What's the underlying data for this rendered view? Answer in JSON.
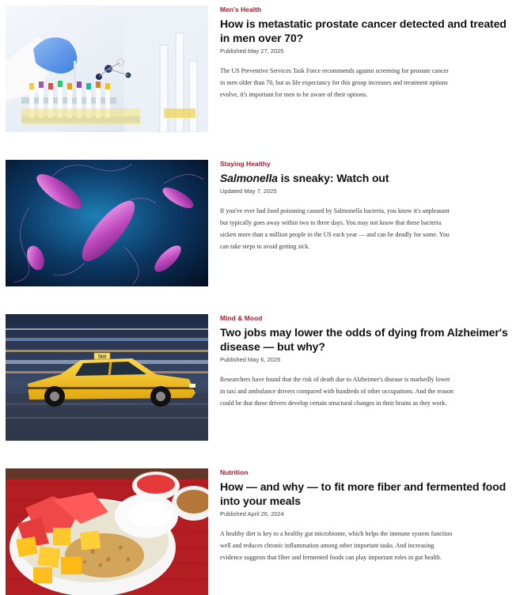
{
  "articles": [
    {
      "category": "Men's Health",
      "title": "How is metastatic prostate cancer detected and treated in men over 70?",
      "date": "Published May 27, 2025",
      "summary": "The US Preventive Services Task Force recommends against screening for prostate cancer in men older than 70, but as life expectancy for this group increases and treatment options evolve, it's important for men to be aware of their options.",
      "image": "lab-test-tubes-image"
    },
    {
      "category": "Staying Healthy",
      "title_italic": "Salmonella",
      "title_rest": " is sneaky: Watch out",
      "date": "Updated May 7, 2025",
      "summary": "If you've ever had food poisoning caused by Salmonella bacteria, you know it's unpleasant but typically goes away within two to three days. You may not know that these bacteria sicken more than a million people in the US each year — and can be deadly for some. You can take steps to avoid getting sick.",
      "image": "bacteria-image"
    },
    {
      "category": "Mind & Mood",
      "title": "Two jobs may lower the odds of dying from Alzheimer's disease — but why?",
      "date": "Published May 6, 2025",
      "summary": "Researchers have found that the risk of death due to Alzheimer's disease is markedly lower in taxi and ambulance drivers compared with hundreds of other occupations. And the reason could be that these drivers develop certain structural changes in their brains as they work.",
      "image": "taxi-image",
      "taxi_sign": "TAXI"
    },
    {
      "category": "Nutrition",
      "title": "How — and why — to fit more fiber and fermented food into your meals",
      "date": "Published April 26, 2024",
      "summary": "A healthy diet is key to a healthy gut microbiome, which helps the immune system function well and reduces chronic inflammation among other important tasks. And increasing evidence suggests that fiber and fermented foods can play important roles in gut health.",
      "image": "fruit-yogurt-bowl-image"
    }
  ],
  "colors": {
    "category": "#a51c30",
    "title": "#111111",
    "body": "#333333"
  }
}
